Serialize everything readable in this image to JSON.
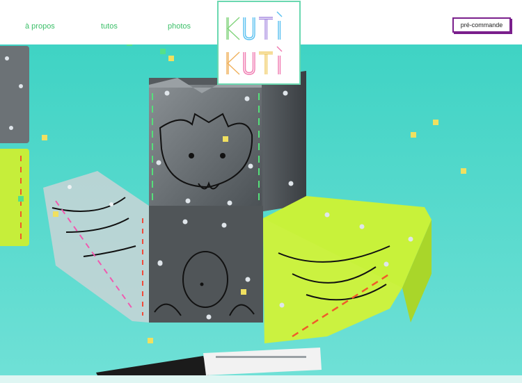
{
  "nav": {
    "items": [
      {
        "label": "à propos"
      },
      {
        "label": "tutos"
      },
      {
        "label": "photos"
      }
    ],
    "cta_label": "pré-commande"
  },
  "logo": {
    "line1": "KUTÌ",
    "line2": "KUTÌ"
  },
  "colors": {
    "nav_text": "#3bbf68",
    "hero_background": "#4fd6c7",
    "cta_border": "#7a1f8c",
    "lime": "#c8f23a"
  }
}
